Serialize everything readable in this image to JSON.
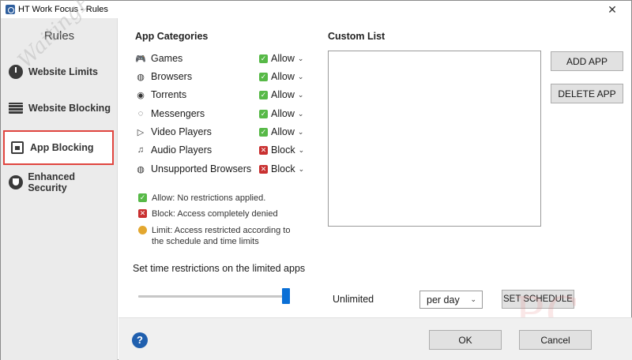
{
  "window": {
    "title": "HT Work Focus - Rules",
    "close_glyph": "✕"
  },
  "sidebar": {
    "heading": "Rules",
    "watermark": "WaitingPC",
    "items": [
      {
        "label": "Website Limits",
        "icon": "clock-icon"
      },
      {
        "label": "Website Blocking",
        "icon": "brick-wall-icon"
      },
      {
        "label": "App Blocking",
        "icon": "lock-window-icon",
        "active": true
      },
      {
        "label": "Enhanced Security",
        "icon": "shield-check-icon"
      }
    ]
  },
  "app_categories": {
    "title": "App Categories",
    "items": [
      {
        "label": "Games",
        "status": "Allow",
        "icon": "gamepad-icon"
      },
      {
        "label": "Browsers",
        "status": "Allow",
        "icon": "globe-icon"
      },
      {
        "label": "Torrents",
        "status": "Allow",
        "icon": "torrent-icon"
      },
      {
        "label": "Messengers",
        "status": "Allow",
        "icon": "messenger-icon"
      },
      {
        "label": "Video Players",
        "status": "Allow",
        "icon": "play-icon"
      },
      {
        "label": "Audio Players",
        "status": "Block",
        "icon": "music-note-icon"
      },
      {
        "label": "Unsupported Browsers",
        "status": "Block",
        "icon": "globe-icon"
      }
    ]
  },
  "legend": {
    "allow": "Allow: No restrictions applied.",
    "block": "Block: Access completely denied",
    "limit_line1": "Limit: Access restricted according to",
    "limit_line2": "the schedule and time limits"
  },
  "custom_list": {
    "title": "Custom List",
    "add_button": "ADD APP",
    "delete_button": "DELETE APP"
  },
  "time_restrictions": {
    "label": "Set time restrictions on the limited apps",
    "slider_value_fraction": 1.0,
    "value_label": "Unlimited",
    "period_selected": "per day",
    "schedule_button": "SET SCHEDULE"
  },
  "footer": {
    "help_glyph": "?",
    "ok_button": "OK",
    "cancel_button": "Cancel"
  },
  "colors": {
    "allow": "#57b947",
    "block": "#c93030",
    "limit": "#e3a72f",
    "active_border": "#e0453f",
    "slider_thumb": "#0a6fd6",
    "help_icon": "#1f5fae"
  }
}
